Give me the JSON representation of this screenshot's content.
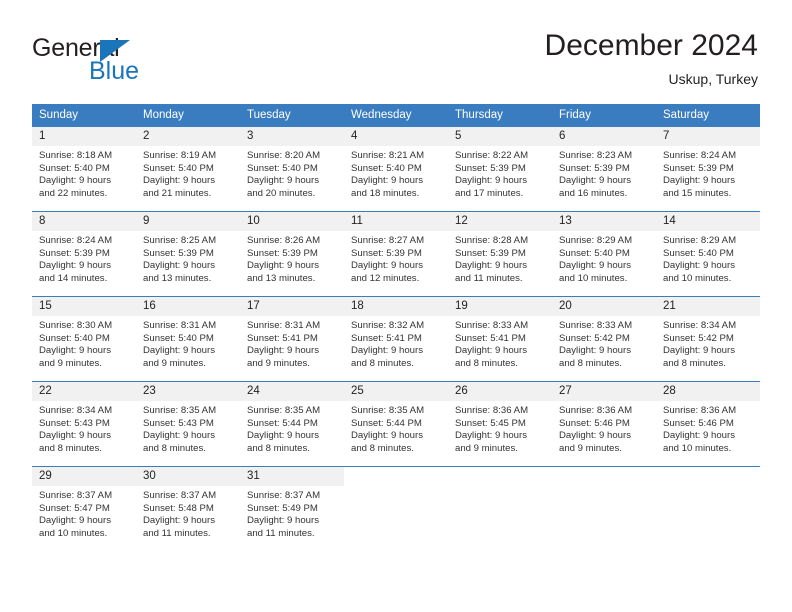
{
  "brand": {
    "name_top": "General",
    "name_bottom": "Blue",
    "triangle_color": "#1b75bb"
  },
  "header": {
    "title": "December 2024",
    "subtitle": "Uskup, Turkey"
  },
  "theme": {
    "header_blue": "#3a7cc0",
    "daynum_bg": "#f1f1f1",
    "text": "#231f20"
  },
  "weekday_headers": [
    "Sunday",
    "Monday",
    "Tuesday",
    "Wednesday",
    "Thursday",
    "Friday",
    "Saturday"
  ],
  "weeks": [
    [
      {
        "day": "1",
        "sunrise": "Sunrise: 8:18 AM",
        "sunset": "Sunset: 5:40 PM",
        "daylight1": "Daylight: 9 hours",
        "daylight2": "and 22 minutes."
      },
      {
        "day": "2",
        "sunrise": "Sunrise: 8:19 AM",
        "sunset": "Sunset: 5:40 PM",
        "daylight1": "Daylight: 9 hours",
        "daylight2": "and 21 minutes."
      },
      {
        "day": "3",
        "sunrise": "Sunrise: 8:20 AM",
        "sunset": "Sunset: 5:40 PM",
        "daylight1": "Daylight: 9 hours",
        "daylight2": "and 20 minutes."
      },
      {
        "day": "4",
        "sunrise": "Sunrise: 8:21 AM",
        "sunset": "Sunset: 5:40 PM",
        "daylight1": "Daylight: 9 hours",
        "daylight2": "and 18 minutes."
      },
      {
        "day": "5",
        "sunrise": "Sunrise: 8:22 AM",
        "sunset": "Sunset: 5:39 PM",
        "daylight1": "Daylight: 9 hours",
        "daylight2": "and 17 minutes."
      },
      {
        "day": "6",
        "sunrise": "Sunrise: 8:23 AM",
        "sunset": "Sunset: 5:39 PM",
        "daylight1": "Daylight: 9 hours",
        "daylight2": "and 16 minutes."
      },
      {
        "day": "7",
        "sunrise": "Sunrise: 8:24 AM",
        "sunset": "Sunset: 5:39 PM",
        "daylight1": "Daylight: 9 hours",
        "daylight2": "and 15 minutes."
      }
    ],
    [
      {
        "day": "8",
        "sunrise": "Sunrise: 8:24 AM",
        "sunset": "Sunset: 5:39 PM",
        "daylight1": "Daylight: 9 hours",
        "daylight2": "and 14 minutes."
      },
      {
        "day": "9",
        "sunrise": "Sunrise: 8:25 AM",
        "sunset": "Sunset: 5:39 PM",
        "daylight1": "Daylight: 9 hours",
        "daylight2": "and 13 minutes."
      },
      {
        "day": "10",
        "sunrise": "Sunrise: 8:26 AM",
        "sunset": "Sunset: 5:39 PM",
        "daylight1": "Daylight: 9 hours",
        "daylight2": "and 13 minutes."
      },
      {
        "day": "11",
        "sunrise": "Sunrise: 8:27 AM",
        "sunset": "Sunset: 5:39 PM",
        "daylight1": "Daylight: 9 hours",
        "daylight2": "and 12 minutes."
      },
      {
        "day": "12",
        "sunrise": "Sunrise: 8:28 AM",
        "sunset": "Sunset: 5:39 PM",
        "daylight1": "Daylight: 9 hours",
        "daylight2": "and 11 minutes."
      },
      {
        "day": "13",
        "sunrise": "Sunrise: 8:29 AM",
        "sunset": "Sunset: 5:40 PM",
        "daylight1": "Daylight: 9 hours",
        "daylight2": "and 10 minutes."
      },
      {
        "day": "14",
        "sunrise": "Sunrise: 8:29 AM",
        "sunset": "Sunset: 5:40 PM",
        "daylight1": "Daylight: 9 hours",
        "daylight2": "and 10 minutes."
      }
    ],
    [
      {
        "day": "15",
        "sunrise": "Sunrise: 8:30 AM",
        "sunset": "Sunset: 5:40 PM",
        "daylight1": "Daylight: 9 hours",
        "daylight2": "and 9 minutes."
      },
      {
        "day": "16",
        "sunrise": "Sunrise: 8:31 AM",
        "sunset": "Sunset: 5:40 PM",
        "daylight1": "Daylight: 9 hours",
        "daylight2": "and 9 minutes."
      },
      {
        "day": "17",
        "sunrise": "Sunrise: 8:31 AM",
        "sunset": "Sunset: 5:41 PM",
        "daylight1": "Daylight: 9 hours",
        "daylight2": "and 9 minutes."
      },
      {
        "day": "18",
        "sunrise": "Sunrise: 8:32 AM",
        "sunset": "Sunset: 5:41 PM",
        "daylight1": "Daylight: 9 hours",
        "daylight2": "and 8 minutes."
      },
      {
        "day": "19",
        "sunrise": "Sunrise: 8:33 AM",
        "sunset": "Sunset: 5:41 PM",
        "daylight1": "Daylight: 9 hours",
        "daylight2": "and 8 minutes."
      },
      {
        "day": "20",
        "sunrise": "Sunrise: 8:33 AM",
        "sunset": "Sunset: 5:42 PM",
        "daylight1": "Daylight: 9 hours",
        "daylight2": "and 8 minutes."
      },
      {
        "day": "21",
        "sunrise": "Sunrise: 8:34 AM",
        "sunset": "Sunset: 5:42 PM",
        "daylight1": "Daylight: 9 hours",
        "daylight2": "and 8 minutes."
      }
    ],
    [
      {
        "day": "22",
        "sunrise": "Sunrise: 8:34 AM",
        "sunset": "Sunset: 5:43 PM",
        "daylight1": "Daylight: 9 hours",
        "daylight2": "and 8 minutes."
      },
      {
        "day": "23",
        "sunrise": "Sunrise: 8:35 AM",
        "sunset": "Sunset: 5:43 PM",
        "daylight1": "Daylight: 9 hours",
        "daylight2": "and 8 minutes."
      },
      {
        "day": "24",
        "sunrise": "Sunrise: 8:35 AM",
        "sunset": "Sunset: 5:44 PM",
        "daylight1": "Daylight: 9 hours",
        "daylight2": "and 8 minutes."
      },
      {
        "day": "25",
        "sunrise": "Sunrise: 8:35 AM",
        "sunset": "Sunset: 5:44 PM",
        "daylight1": "Daylight: 9 hours",
        "daylight2": "and 8 minutes."
      },
      {
        "day": "26",
        "sunrise": "Sunrise: 8:36 AM",
        "sunset": "Sunset: 5:45 PM",
        "daylight1": "Daylight: 9 hours",
        "daylight2": "and 9 minutes."
      },
      {
        "day": "27",
        "sunrise": "Sunrise: 8:36 AM",
        "sunset": "Sunset: 5:46 PM",
        "daylight1": "Daylight: 9 hours",
        "daylight2": "and 9 minutes."
      },
      {
        "day": "28",
        "sunrise": "Sunrise: 8:36 AM",
        "sunset": "Sunset: 5:46 PM",
        "daylight1": "Daylight: 9 hours",
        "daylight2": "and 10 minutes."
      }
    ],
    [
      {
        "day": "29",
        "sunrise": "Sunrise: 8:37 AM",
        "sunset": "Sunset: 5:47 PM",
        "daylight1": "Daylight: 9 hours",
        "daylight2": "and 10 minutes."
      },
      {
        "day": "30",
        "sunrise": "Sunrise: 8:37 AM",
        "sunset": "Sunset: 5:48 PM",
        "daylight1": "Daylight: 9 hours",
        "daylight2": "and 11 minutes."
      },
      {
        "day": "31",
        "sunrise": "Sunrise: 8:37 AM",
        "sunset": "Sunset: 5:49 PM",
        "daylight1": "Daylight: 9 hours",
        "daylight2": "and 11 minutes."
      },
      {
        "day": "",
        "sunrise": "",
        "sunset": "",
        "daylight1": "",
        "daylight2": ""
      },
      {
        "day": "",
        "sunrise": "",
        "sunset": "",
        "daylight1": "",
        "daylight2": ""
      },
      {
        "day": "",
        "sunrise": "",
        "sunset": "",
        "daylight1": "",
        "daylight2": ""
      },
      {
        "day": "",
        "sunrise": "",
        "sunset": "",
        "daylight1": "",
        "daylight2": ""
      }
    ]
  ]
}
